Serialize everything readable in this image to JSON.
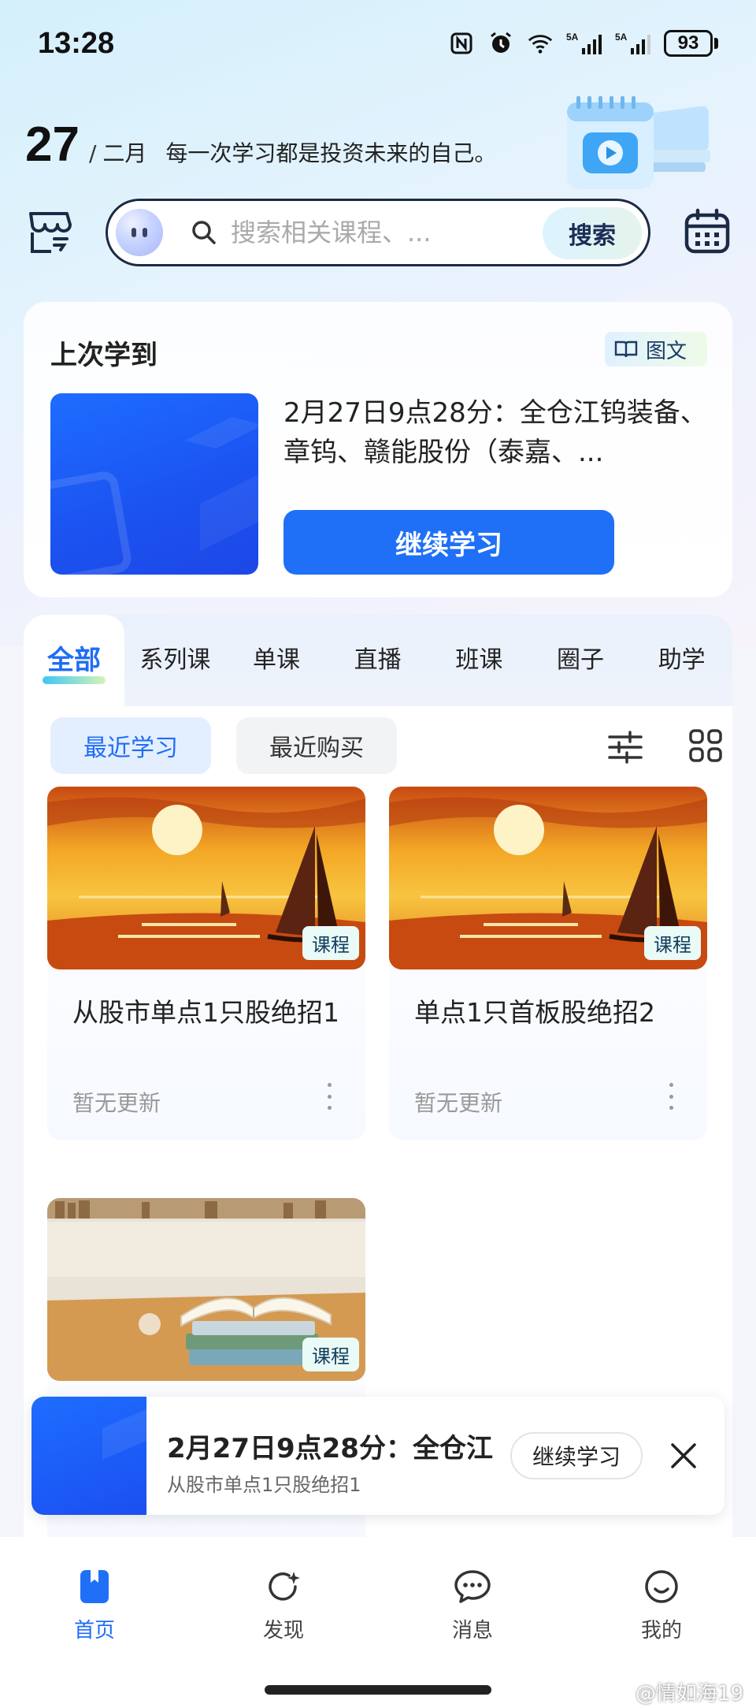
{
  "status_bar": {
    "time": "13:28",
    "network_a": "5A",
    "network_b": "5A",
    "battery": "93"
  },
  "header": {
    "day": "27",
    "separator": "/",
    "month": "二月",
    "motto": "每一次学习都是投资未来的自己。"
  },
  "search": {
    "placeholder": "搜索相关课程、...",
    "button_label": "搜索"
  },
  "last_study": {
    "title": "上次学到",
    "tag": "图文",
    "description": "2月27日9点28分：全仓江钨装备、章钨、赣能股份（泰嘉、...",
    "continue_label": "继续学习"
  },
  "tabs": [
    {
      "label": "全部",
      "active": true
    },
    {
      "label": "系列课"
    },
    {
      "label": "单课"
    },
    {
      "label": "直播"
    },
    {
      "label": "班课"
    },
    {
      "label": "圈子"
    },
    {
      "label": "助学"
    }
  ],
  "filters": {
    "recent_study": "最近学习",
    "recent_purchase": "最近购买"
  },
  "courses": [
    {
      "title": "从股市单点1只股绝招1",
      "tag": "课程",
      "status": "暂无更新",
      "image": "sunset-sailboat-painting"
    },
    {
      "title": "单点1只首板股绝招2",
      "tag": "课程",
      "status": "暂无更新",
      "image": "sunset-sailboat-painting"
    },
    {
      "title": "",
      "tag": "课程",
      "status": "",
      "image": "stacked-books-library"
    }
  ],
  "mini_player": {
    "title": "2月27日9点28分：全仓江",
    "subtitle": "从股市单点1只股绝招1",
    "continue_label": "继续学习"
  },
  "bottom_nav": [
    {
      "label": "首页",
      "icon": "home-icon",
      "active": true
    },
    {
      "label": "发现",
      "icon": "discover-icon"
    },
    {
      "label": "消息",
      "icon": "message-icon"
    },
    {
      "label": "我的",
      "icon": "profile-icon"
    }
  ],
  "watermark": "@情如海19",
  "colors": {
    "accent": "#1f70f6",
    "active_tab": "#1f6df6",
    "chip_active_bg": "#e3effe"
  }
}
